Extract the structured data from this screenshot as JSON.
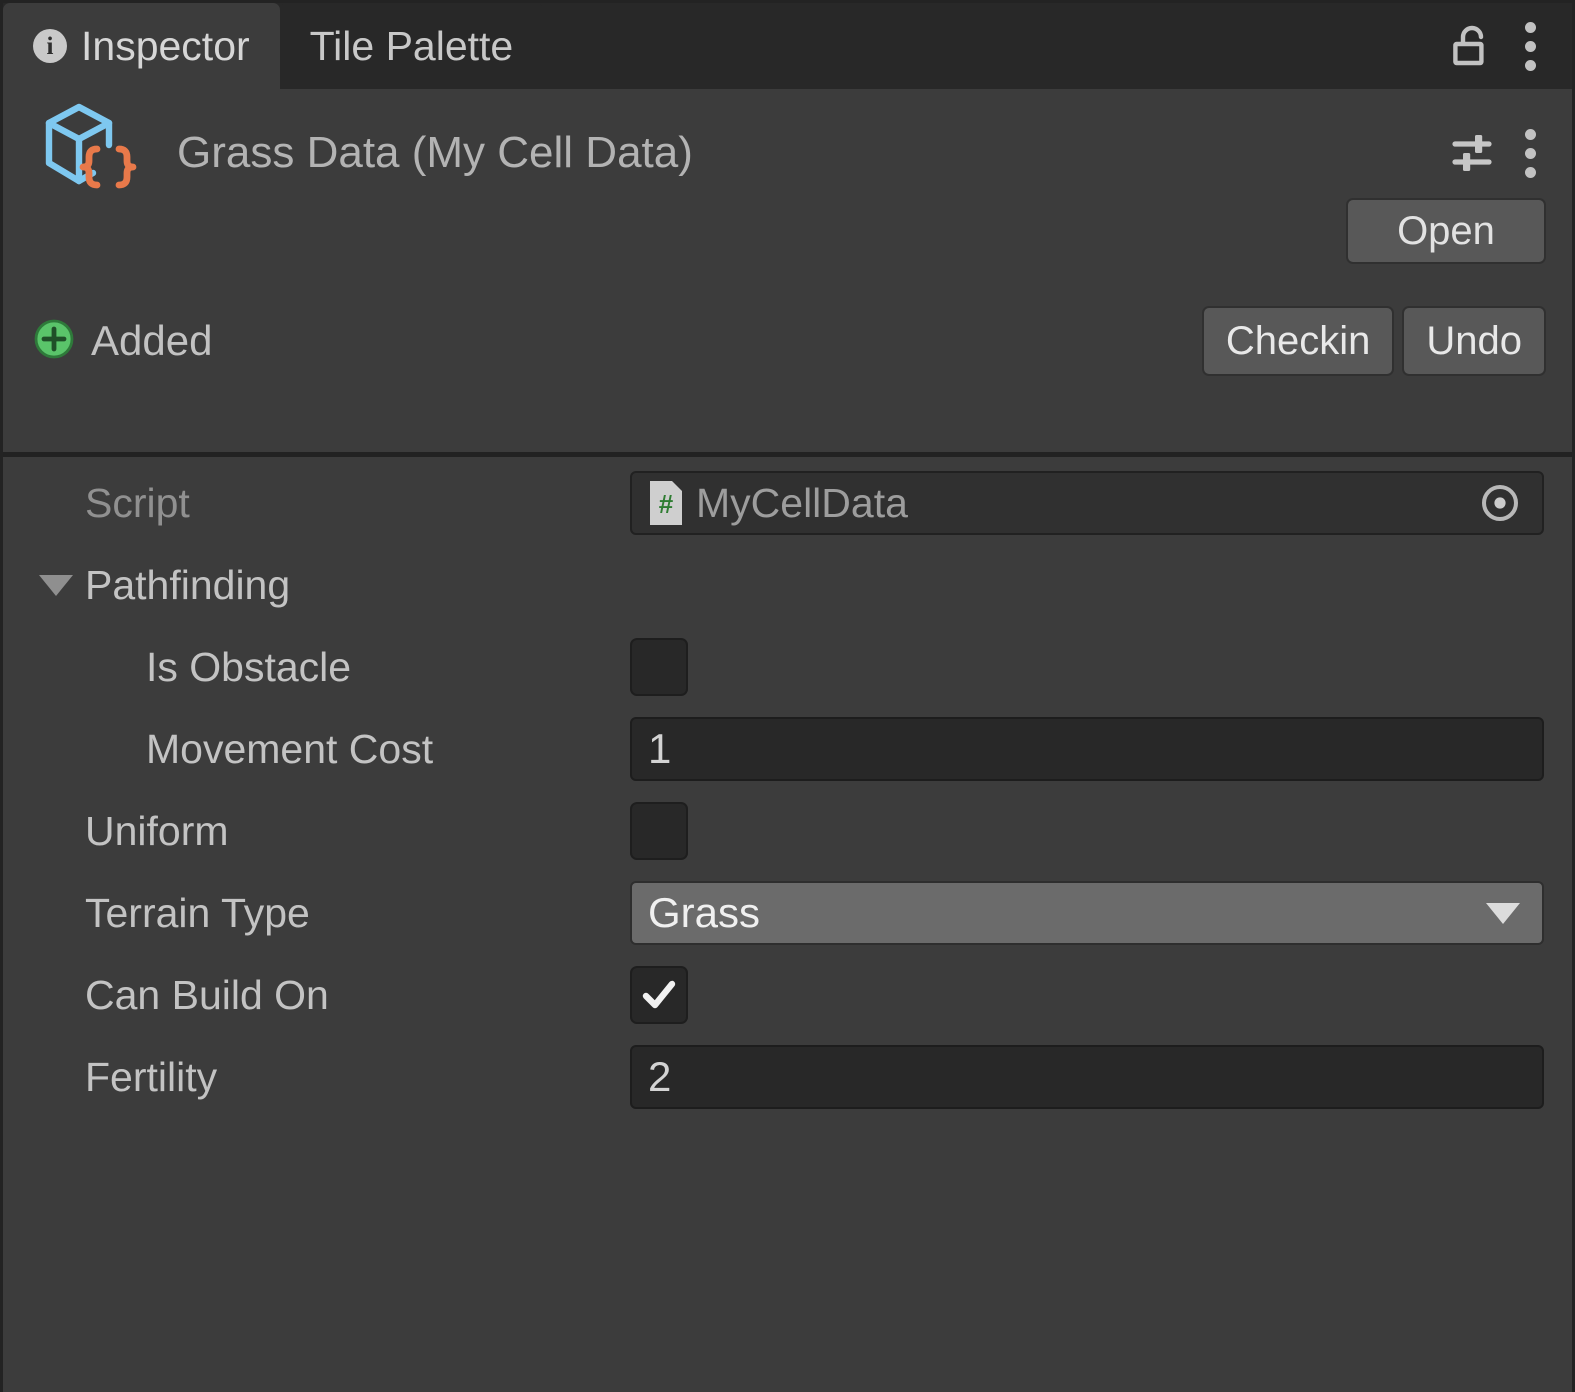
{
  "window": {
    "tabs": [
      {
        "label": "Inspector",
        "icon": "info-icon",
        "active": true
      },
      {
        "label": "Tile Palette",
        "icon": "",
        "active": false
      }
    ],
    "lock_icon": "unlocked-padlock-icon",
    "menu_icon": "kebab-menu-icon"
  },
  "object_header": {
    "icon": "scriptable-object-icon",
    "title": "Grass Data (My Cell Data)",
    "preset_icon": "preset-sliders-icon",
    "menu_icon": "kebab-menu-icon",
    "open_label": "Open"
  },
  "version_control": {
    "status_icon": "added-plus-icon",
    "status_label": "Added",
    "checkin_label": "Checkin",
    "undo_label": "Undo"
  },
  "properties": {
    "script": {
      "label": "Script",
      "value": "MyCellData",
      "type_icon": "csharp-script-icon",
      "picker_icon": "object-picker-icon"
    },
    "pathfinding": {
      "label": "Pathfinding",
      "expanded": true,
      "arrow_icon": "triangle-down-icon",
      "children": [
        {
          "label": "Is Obstacle",
          "type": "checkbox",
          "value": false
        },
        {
          "label": "Movement Cost",
          "type": "number",
          "value": "1"
        }
      ]
    },
    "uniform": {
      "label": "Uniform",
      "type": "checkbox",
      "value": false
    },
    "terrain_type": {
      "label": "Terrain Type",
      "type": "dropdown",
      "value": "Grass",
      "arrow_icon": "dropdown-arrow-icon"
    },
    "can_build_on": {
      "label": "Can Build On",
      "type": "checkbox",
      "value": true
    },
    "fertility": {
      "label": "Fertility",
      "type": "number",
      "value": "2"
    }
  },
  "colors": {
    "panel_bg": "#3c3c3c",
    "tabbar_bg": "#282828",
    "field_bg": "#282828",
    "button_bg": "#585858",
    "dropdown_bg": "#6b6b6b",
    "accent_cube": "#7ec8f0",
    "accent_braces": "#e8794a",
    "added_green": "#5ac46a",
    "script_hash_green": "#2f7d32"
  }
}
